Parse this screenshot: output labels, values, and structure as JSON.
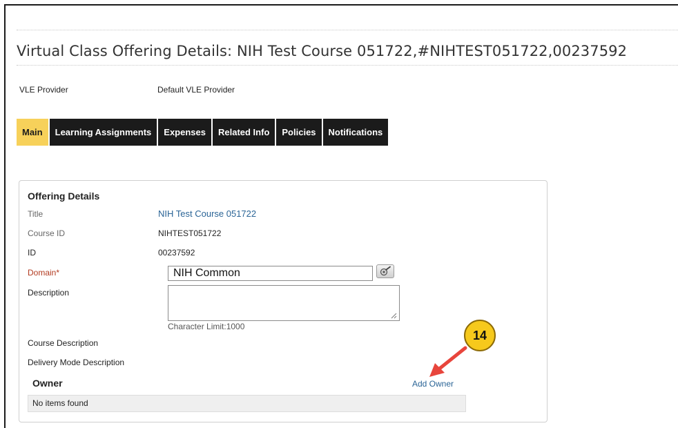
{
  "page": {
    "title": "Virtual Class Offering Details: NIH Test Course 051722,#NIHTEST051722,00237592"
  },
  "vle": {
    "label": "VLE Provider",
    "value": "Default VLE Provider"
  },
  "tabs": [
    {
      "label": "Main",
      "active": true
    },
    {
      "label": "Learning Assignments",
      "active": false
    },
    {
      "label": "Expenses",
      "active": false
    },
    {
      "label": "Related Info",
      "active": false
    },
    {
      "label": "Policies",
      "active": false
    },
    {
      "label": "Notifications",
      "active": false
    }
  ],
  "offering": {
    "heading": "Offering Details",
    "fields": {
      "title_label": "Title",
      "title_value": "NIH Test Course 051722",
      "course_id_label": "Course ID",
      "course_id_value": "NIHTEST051722",
      "id_label": "ID",
      "id_value": "00237592",
      "domain_label": "Domain*",
      "domain_value": "NIH Common",
      "description_label": "Description",
      "description_value": "",
      "char_limit": "Character Limit:1000",
      "course_description_label": "Course Description",
      "delivery_mode_label": "Delivery Mode Description"
    }
  },
  "owner": {
    "heading": "Owner",
    "add_label": "Add Owner",
    "empty_text": "No items found"
  },
  "annotation": {
    "step_number": "14",
    "color": "#f6c91c",
    "arrow_color": "#e8453c"
  },
  "colors": {
    "tab_bg": "#1b1b1b",
    "tab_active_bg": "#f7d15a",
    "link": "#2a6496",
    "required": "#b23a1f"
  },
  "icons": {
    "domain_picker": "search-picker-icon",
    "textarea_resize": "resize-grip-icon"
  }
}
